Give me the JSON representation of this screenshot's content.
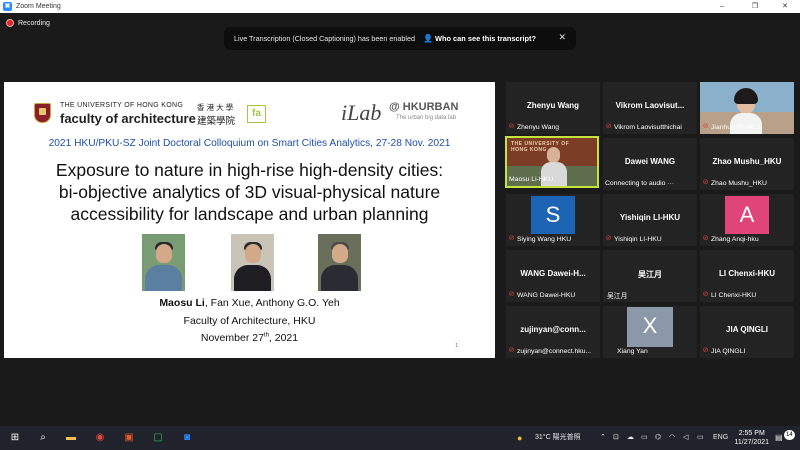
{
  "window": {
    "title": "Zoom Meeting",
    "minimize": "–",
    "restore": "❐",
    "close": "✕"
  },
  "recording": {
    "label": "Recording"
  },
  "banner": {
    "message": "Live Transcription (Closed Captioning) has been enabled",
    "who_label": "Who can see this transcript?",
    "close": "✕"
  },
  "slide": {
    "university": "THE UNIVERSITY OF HONG KONG",
    "university_cn": "香 港 大 學",
    "faculty": "faculty of architecture",
    "faculty_cn": "建築學院",
    "fa_logo": "fa",
    "ilab": "iLab",
    "hkurban": "@ HKURBAN",
    "hkurban_sub": "The urban big data lab",
    "conference": "2021 HKU/PKU-SZ Joint Doctoral Colloquium on Smart Cities Analytics, 27-28 Nov. 2021",
    "title_line1": "Exposure to nature in high-rise high-density cities:",
    "title_line2": "bi-objective analytics of 3D visual-physical nature",
    "title_line3": "accessibility for landscape and urban planning",
    "author_lead": "Maosu Li",
    "author_rest": ", Fan Xue, Anthony G.O. Yeh",
    "affiliation": "Faculty of Architecture, HKU",
    "date_day": "November 27",
    "date_suffix": "th",
    "date_year": ", 2021",
    "page_number": "1"
  },
  "participants": [
    {
      "center": "Zhenyu Wang",
      "name": "Zhenyu Wang"
    },
    {
      "center": "Vikrom  Laovisut...",
      "name": "Vikrom Laovisutthichai"
    },
    {
      "center": "",
      "name": "Jianhua PI-HKU"
    },
    {
      "center": "",
      "name": "Maosu Li-HKU"
    },
    {
      "center": "Dawei WANG",
      "name": "Connecting to audio ···"
    },
    {
      "center": "Zhao Mushu_HKU",
      "name": "Zhao Mushu_HKU"
    },
    {
      "center": "S",
      "name": "Siying Wang HKU"
    },
    {
      "center": "Yishiqin LI-HKU",
      "name": "Yishiqin LI-HKU"
    },
    {
      "center": "A",
      "name": "Zhang Anqi-hku"
    },
    {
      "center": "WANG Dawei-H...",
      "name": "WANG Dawei-HKU"
    },
    {
      "center": "吴江月",
      "name": "吴江月"
    },
    {
      "center": "LI Chenxi-HKU",
      "name": "LI Chenxi-HKU"
    },
    {
      "center": "zujinyan@conn...",
      "name": "zujinyan@connect.hku..."
    },
    {
      "center": "X",
      "name": "Xiang Yan"
    },
    {
      "center": "JIA QINGLI",
      "name": "JIA QINGLI"
    }
  ],
  "colors": {
    "avatar_s": "#1e64b4",
    "avatar_a": "#e0457a",
    "avatar_x": "#8a98a8",
    "active_border": "#c7e23a"
  },
  "taskbar": {
    "weather": "31°C 陽光普照",
    "lang": "ENG",
    "time": "2:55 PM",
    "date": "11/27/2021",
    "notification_count": "14"
  }
}
